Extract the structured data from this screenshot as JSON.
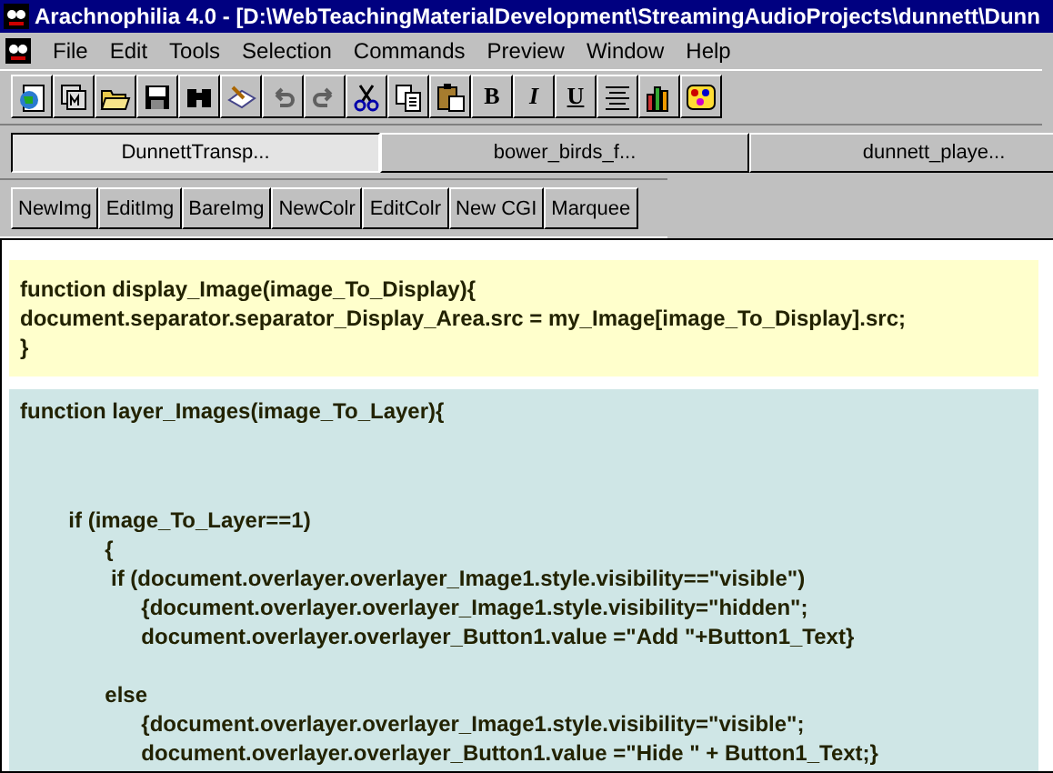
{
  "window": {
    "title": "Arachnophilia 4.0 - [D:\\WebTeachingMaterialDevelopment\\StreamingAudioProjects\\dunnett\\Dunn"
  },
  "menu": [
    "File",
    "Edit",
    "Tools",
    "Selection",
    "Commands",
    "Preview",
    "Window",
    "Help"
  ],
  "toolbar": [
    {
      "kind": "globe",
      "disabled": false
    },
    {
      "kind": "frames",
      "disabled": false
    },
    {
      "kind": "folder",
      "disabled": false
    },
    {
      "kind": "disk",
      "disabled": false
    },
    {
      "kind": "binoculars",
      "disabled": false
    },
    {
      "kind": "pencil",
      "disabled": false
    },
    {
      "kind": "undo",
      "disabled": true
    },
    {
      "kind": "redo",
      "disabled": true
    },
    {
      "kind": "scissors",
      "disabled": false
    },
    {
      "kind": "copy",
      "disabled": false
    },
    {
      "kind": "paste",
      "disabled": false
    },
    {
      "kind": "text",
      "label": "B",
      "disabled": false
    },
    {
      "kind": "text",
      "label": "I",
      "disabled": false
    },
    {
      "kind": "text",
      "label": "U",
      "disabled": false
    },
    {
      "kind": "center",
      "disabled": false
    },
    {
      "kind": "chart",
      "disabled": false
    },
    {
      "kind": "palette",
      "disabled": false
    }
  ],
  "tabs": [
    {
      "label": "DunnettTransp...",
      "selected": true
    },
    {
      "label": "bower_birds_f...",
      "selected": false
    },
    {
      "label": "dunnett_playe...",
      "selected": false
    }
  ],
  "buttons": [
    "NewImg",
    "EditImg",
    "BareImg",
    "NewColr",
    "EditColr",
    "New CGI",
    "Marquee"
  ],
  "blocks": [
    {
      "kind": "yellow",
      "paragraphs": [
        [
          "function display_Image(image_To_Display){",
          "document.separator.separator_Display_Area.src = my_Image[image_To_Display].src;",
          "}"
        ]
      ]
    },
    {
      "kind": "blue",
      "paragraphs": [
        [
          "function layer_Images(image_To_Layer){"
        ],
        [
          "        if (image_To_Layer==1)",
          "              {",
          "               if (document.overlayer.overlayer_Image1.style.visibility==\"visible\")",
          "                    {document.overlayer.overlayer_Image1.style.visibility=\"hidden\";",
          "                    document.overlayer.overlayer_Button1.value =\"Add \"+Button1_Text}"
        ],
        [
          "              else",
          "                    {document.overlayer.overlayer_Image1.style.visibility=\"visible\";",
          "                    document.overlayer.overlayer_Button1.value =\"Hide \" + Button1_Text;}"
        ]
      ]
    }
  ]
}
